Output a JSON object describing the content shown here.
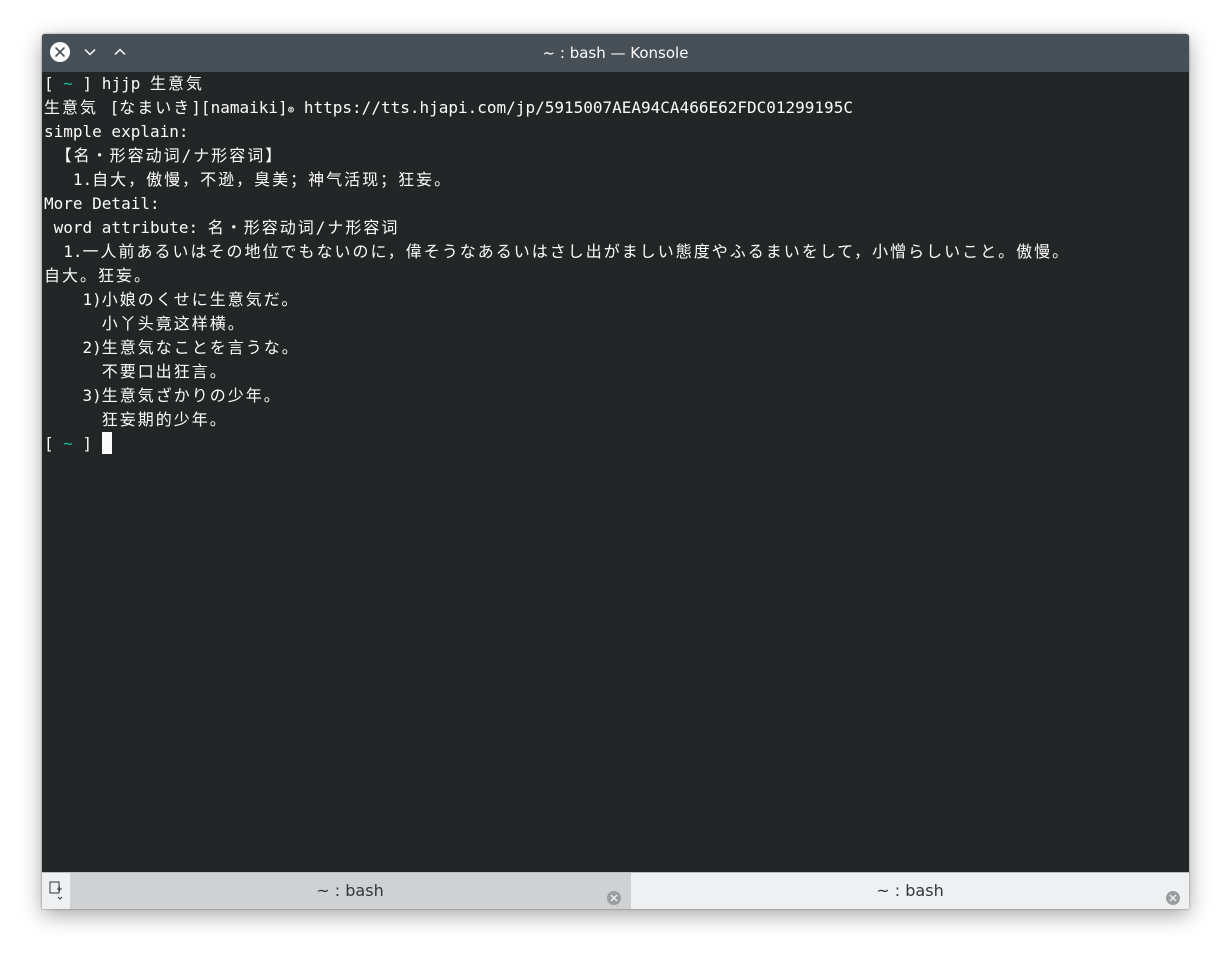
{
  "window": {
    "title": "~ : bash — Konsole"
  },
  "terminal": {
    "lines": [
      {
        "segments": [
          {
            "text": "[ ",
            "style": "normal"
          },
          {
            "text": "~",
            "style": "tilde"
          },
          {
            "text": " ] hjjp ",
            "style": "normal"
          },
          {
            "text": "生意気",
            "style": "cjk"
          }
        ]
      },
      {
        "segments": [
          {
            "text": "生意気 ",
            "style": "cjk"
          },
          {
            "text": "[",
            "style": "normal"
          },
          {
            "text": "なまいき",
            "style": "cjk"
          },
          {
            "text": "][namaiki]",
            "style": "normal"
          },
          {
            "text": "⊚",
            "style": "linksym"
          },
          {
            "text": " https://tts.hjapi.com/jp/5915007AEA94CA466E62FDC01299195C",
            "style": "normal"
          }
        ]
      },
      {
        "segments": [
          {
            "text": "simple explain:",
            "style": "normal"
          }
        ]
      },
      {
        "segments": [
          {
            "text": " 【名・形容动词/ナ形容词】",
            "style": "cjk"
          }
        ]
      },
      {
        "segments": [
          {
            "text": "   1.",
            "style": "normal"
          },
          {
            "text": "自大，傲慢，不逊，臭美；神气活现；狂妄。",
            "style": "cjk"
          }
        ]
      },
      {
        "segments": [
          {
            "text": "More Detail:",
            "style": "normal"
          }
        ]
      },
      {
        "segments": [
          {
            "text": " word attribute: ",
            "style": "normal"
          },
          {
            "text": "名・形容动词/ナ形容词",
            "style": "cjk"
          }
        ]
      },
      {
        "segments": [
          {
            "text": "  1.",
            "style": "normal"
          },
          {
            "text": "一人前あるいはその地位でもないのに，偉そうなあるいはさし出がましい態度やふるまいをして，小憎らしいこと。傲慢。",
            "style": "cjk"
          }
        ]
      },
      {
        "segments": [
          {
            "text": "自大。狂妄。",
            "style": "cjk"
          }
        ]
      },
      {
        "segments": [
          {
            "text": "    1)",
            "style": "normal"
          },
          {
            "text": "小娘のくせに生意気だ。",
            "style": "cjk"
          }
        ]
      },
      {
        "segments": [
          {
            "text": "      ",
            "style": "normal"
          },
          {
            "text": "小丫头竟这样横。",
            "style": "cjk"
          }
        ]
      },
      {
        "segments": [
          {
            "text": "    2)",
            "style": "normal"
          },
          {
            "text": "生意気なことを言うな。",
            "style": "cjk"
          }
        ]
      },
      {
        "segments": [
          {
            "text": "      ",
            "style": "normal"
          },
          {
            "text": "不要口出狂言。",
            "style": "cjk"
          }
        ]
      },
      {
        "segments": [
          {
            "text": "    3)",
            "style": "normal"
          },
          {
            "text": "生意気ざかりの少年。",
            "style": "cjk"
          }
        ]
      },
      {
        "segments": [
          {
            "text": "      ",
            "style": "normal"
          },
          {
            "text": "狂妄期的少年。",
            "style": "cjk"
          }
        ]
      },
      {
        "segments": [
          {
            "text": "[ ",
            "style": "normal"
          },
          {
            "text": "~",
            "style": "tilde"
          },
          {
            "text": " ] ",
            "style": "normal"
          }
        ],
        "cursor": true
      }
    ]
  },
  "tabs": [
    {
      "label": "~ : bash",
      "active": false
    },
    {
      "label": "~ : bash",
      "active": true
    }
  ],
  "icons": {
    "close": "close-icon",
    "minimize": "chevron-down-icon",
    "maximize": "chevron-up-icon",
    "new_tab": "new-tab-icon",
    "tab_close": "tab-close-icon"
  },
  "colors": {
    "titlebar": "#475057",
    "terminal_bg": "#232627",
    "terminal_fg": "#fcfcfc",
    "prompt_tilde": "#1abc9c",
    "tab_active_bg": "#eff0f1",
    "tab_inactive_bg": "#d0d1d2"
  }
}
